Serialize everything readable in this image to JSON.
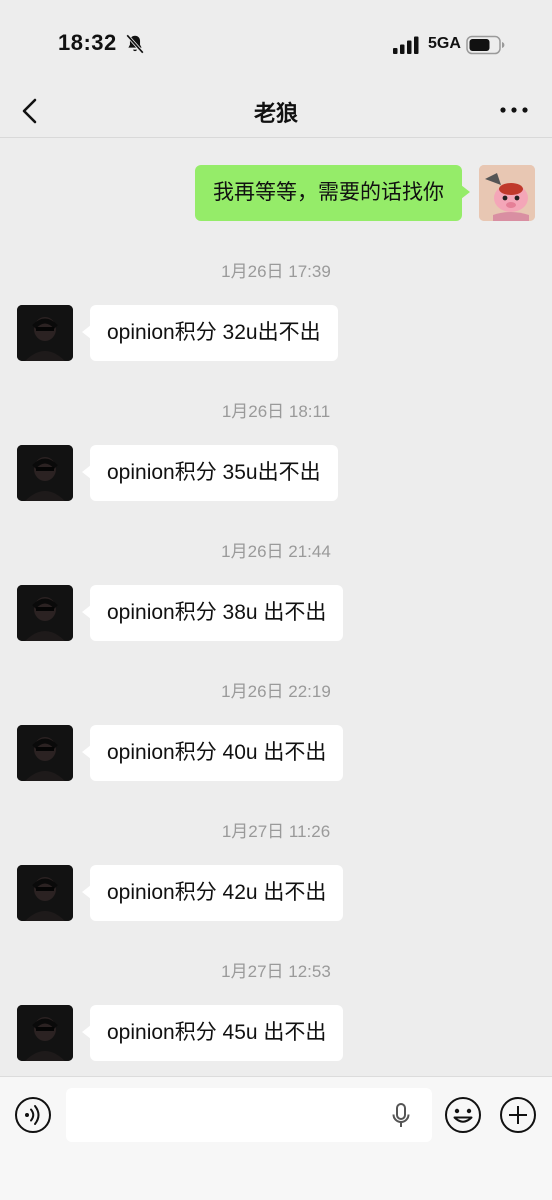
{
  "status_bar": {
    "time": "18:32",
    "network": "5GA",
    "icons": [
      "bell-muted-icon",
      "signal-icon",
      "battery-icon"
    ]
  },
  "nav": {
    "title": "老狼",
    "icons": [
      "back-arrow-icon",
      "more-icon"
    ]
  },
  "my_message": {
    "text": "我再等等，需要的话找你",
    "bubble_color": "#95ec69"
  },
  "conversation": [
    {
      "timestamp": "1月26日 17:39",
      "text": "opinion积分 32u出不出"
    },
    {
      "timestamp": "1月26日 18:11",
      "text": "opinion积分 35u出不出"
    },
    {
      "timestamp": "1月26日 21:44",
      "text": "opinion积分 38u 出不出"
    },
    {
      "timestamp": "1月26日 22:19",
      "text": "opinion积分 40u 出不出"
    },
    {
      "timestamp": "1月27日 11:26",
      "text": "opinion积分 42u 出不出"
    },
    {
      "timestamp": "1月27日 12:53",
      "text": "opinion积分 45u 出不出"
    }
  ],
  "input_bar": {
    "placeholder": "",
    "icons": [
      "voice-icon",
      "mic-icon",
      "emoji-icon",
      "plus-icon"
    ]
  },
  "colors": {
    "background": "#ededed",
    "their_bubble": "#ffffff",
    "timestamp": "#9a9a9a"
  }
}
